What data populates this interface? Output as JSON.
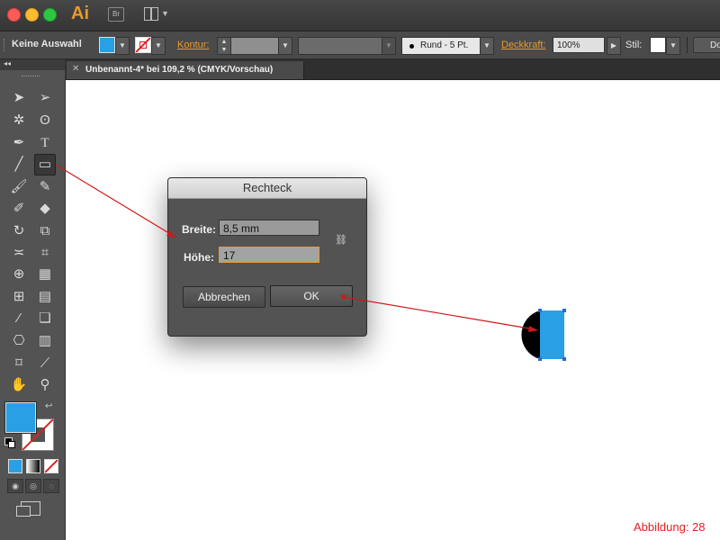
{
  "app": {
    "logo": "Ai",
    "bridge_label": "Br",
    "accent_color": "#e89a2c"
  },
  "control_bar": {
    "selection_status": "Keine Auswahl",
    "fill_color": "#29a0e5",
    "stroke_label": "Kontur:",
    "brush_label": "Rund - 5 Pt.",
    "opacity_label": "Deckkraft:",
    "opacity_value": "100%",
    "style_label": "Stil:",
    "doc_button_label": "Do"
  },
  "document_tab": {
    "title": "Unbenannt-4* bei 109,2 % (CMYK/Vorschau)"
  },
  "toolbar": {
    "tools": [
      "selection-tool-icon",
      "direct-selection-tool-icon",
      "magic-wand-tool-icon",
      "lasso-tool-icon",
      "pen-tool-icon",
      "type-tool-icon",
      "line-tool-icon",
      "rectangle-tool-icon",
      "paintbrush-tool-icon",
      "pencil-tool-icon",
      "blob-brush-tool-icon",
      "eraser-tool-icon",
      "rotate-tool-icon",
      "scale-tool-icon",
      "width-tool-icon",
      "free-transform-tool-icon",
      "shape-builder-tool-icon",
      "perspective-grid-tool-icon",
      "mesh-tool-icon",
      "gradient-tool-icon",
      "eyedropper-tool-icon",
      "blend-tool-icon",
      "symbol-sprayer-tool-icon",
      "column-graph-tool-icon",
      "artboard-tool-icon",
      "slice-tool-icon",
      "hand-tool-icon",
      "zoom-tool-icon"
    ],
    "fill_color": "#29a0e5"
  },
  "dialog": {
    "title": "Rechteck",
    "width_label": "Breite:",
    "width_value": "8,5 mm",
    "height_label": "Höhe:",
    "height_value": "17",
    "cancel_label": "Abbrechen",
    "ok_label": "OK"
  },
  "canvas": {
    "shape_fill": "#29a0e5",
    "circle_fill": "#000000"
  },
  "caption": "Abbildung: 28"
}
